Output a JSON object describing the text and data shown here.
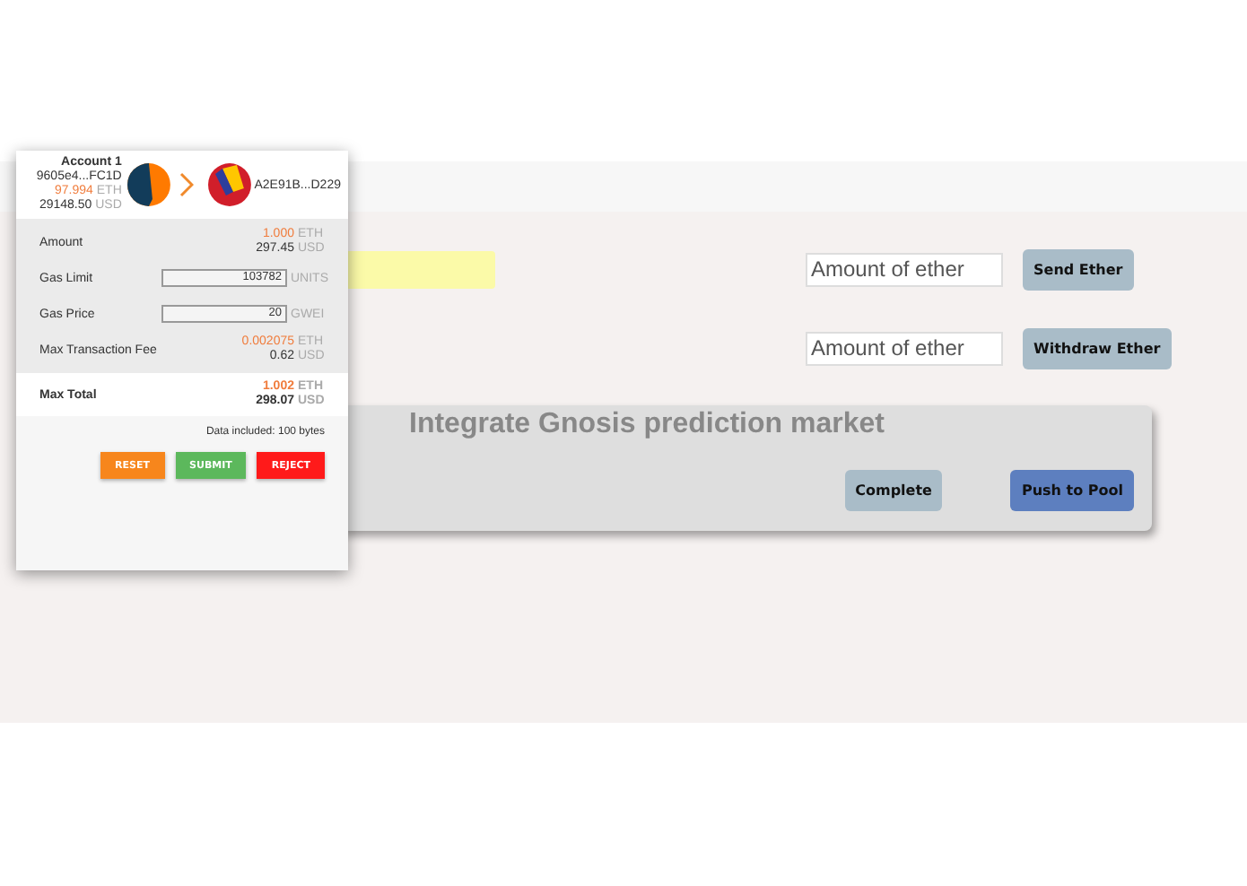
{
  "popup": {
    "account": {
      "name": "Account 1",
      "address": "9605e4...FC1D",
      "balance": "97.994",
      "balance_unit": "ETH",
      "usd": "29148.50",
      "usd_unit": "USD"
    },
    "recipient": {
      "address": "A2E91B...D229"
    },
    "fields": [
      {
        "kind": "amount",
        "label": "Amount",
        "value": "1.000",
        "unit": "ETH",
        "usd": "297.45",
        "usd_unit": "USD"
      },
      {
        "kind": "input",
        "label": "Gas Limit",
        "value": "103782",
        "unit": "UNITS"
      },
      {
        "kind": "input",
        "label": "Gas Price",
        "value": "20",
        "unit": "GWEI"
      },
      {
        "kind": "amount",
        "label": "Max Transaction Fee",
        "value": "0.002075",
        "unit": "ETH",
        "usd": "0.62",
        "usd_unit": "USD"
      },
      {
        "kind": "total",
        "label": "Max Total",
        "value": "1.002",
        "unit": "ETH",
        "usd": "298.07",
        "usd_unit": "USD"
      }
    ],
    "data_note": "Data included: 100 bytes",
    "buttons": [
      {
        "label": "RESET",
        "color": "#f7861c"
      },
      {
        "label": "SUBMIT",
        "color": "#5cb85c"
      },
      {
        "label": "REJECT",
        "color": "#ff1a1a"
      }
    ]
  },
  "rows": [
    {
      "placeholder": "Amount of ether",
      "button": "Send Ether"
    },
    {
      "placeholder": "Amount of ether",
      "button": "Withdraw Ether"
    }
  ],
  "card": {
    "title": "Integrate Gnosis prediction market",
    "buttons": [
      {
        "label": "Complete",
        "kind": "secondary"
      },
      {
        "label": "Push to Pool",
        "kind": "primary"
      }
    ]
  }
}
